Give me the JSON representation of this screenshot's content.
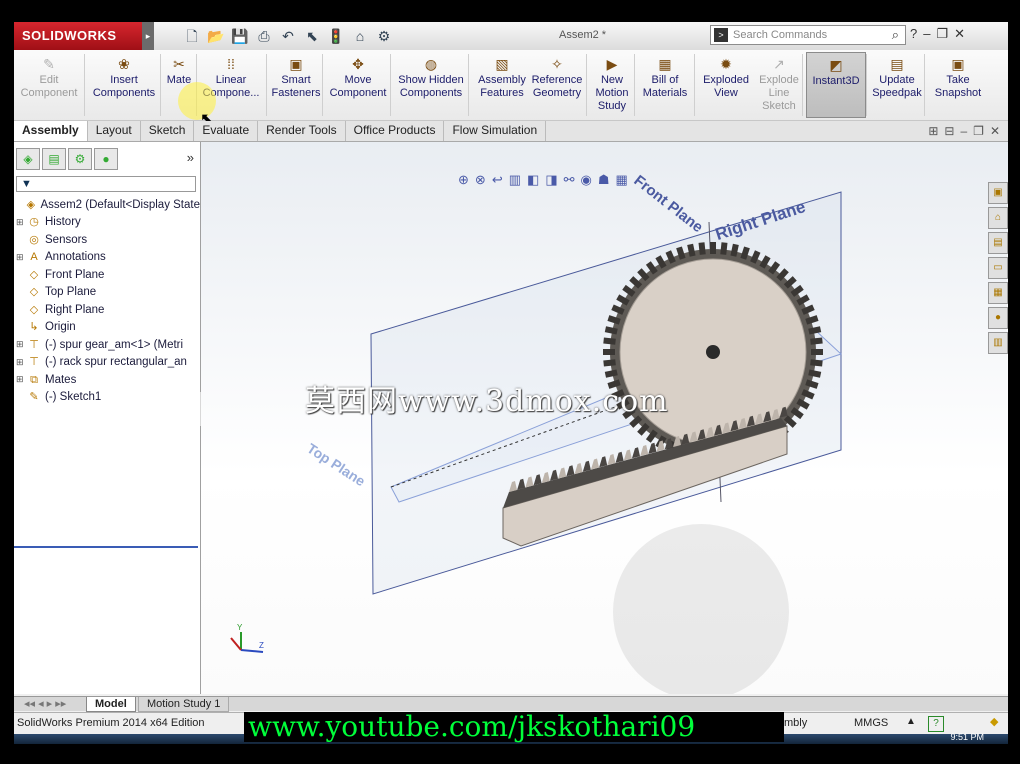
{
  "app": {
    "brand": "SOLIDWORKS",
    "window_title": "Assem2 *",
    "search_placeholder": "Search Commands"
  },
  "ribbon": [
    {
      "id": "edit-component",
      "label": "Edit Component",
      "icon": "edit-component-icon",
      "disabled": true
    },
    {
      "id": "insert-components",
      "label": "Insert Components",
      "icon": "insert-components-icon",
      "disabled": false
    },
    {
      "id": "mate",
      "label": "Mate",
      "icon": "mate-icon",
      "disabled": false
    },
    {
      "id": "linear-component",
      "label": "Linear Compone...",
      "icon": "linear-pattern-icon",
      "disabled": false
    },
    {
      "id": "smart-fasteners",
      "label": "Smart Fasteners",
      "icon": "smart-fasteners-icon",
      "disabled": false
    },
    {
      "id": "move-component",
      "label": "Move Component",
      "icon": "move-component-icon",
      "disabled": false
    },
    {
      "id": "show-hidden",
      "label": "Show Hidden Components",
      "icon": "show-hidden-icon",
      "disabled": false
    },
    {
      "id": "assembly-features",
      "label": "Assembly Features",
      "icon": "assembly-features-icon",
      "disabled": false
    },
    {
      "id": "reference-geometry",
      "label": "Reference Geometry",
      "icon": "reference-geometry-icon",
      "disabled": false
    },
    {
      "id": "new-motion-study",
      "label": "New Motion Study",
      "icon": "motion-study-icon",
      "disabled": false
    },
    {
      "id": "bill-of-materials",
      "label": "Bill of Materials",
      "icon": "bom-icon",
      "disabled": false
    },
    {
      "id": "exploded-view",
      "label": "Exploded View",
      "icon": "exploded-view-icon",
      "disabled": false
    },
    {
      "id": "explode-line-sketch",
      "label": "Explode Line Sketch",
      "icon": "explode-line-icon",
      "disabled": true
    },
    {
      "id": "instant3d",
      "label": "Instant3D",
      "icon": "instant3d-icon",
      "disabled": false,
      "active": true
    },
    {
      "id": "update-speedpak",
      "label": "Update Speedpak",
      "icon": "speedpak-icon",
      "disabled": false
    },
    {
      "id": "take-snapshot",
      "label": "Take Snapshot",
      "icon": "snapshot-icon",
      "disabled": false
    }
  ],
  "tabs": [
    "Assembly",
    "Layout",
    "Sketch",
    "Evaluate",
    "Render Tools",
    "Office Products",
    "Flow Simulation"
  ],
  "active_tab": "Assembly",
  "tree": [
    {
      "label": "Assem2  (Default<Display State",
      "icon": "assembly-icon",
      "exp": ""
    },
    {
      "label": "History",
      "icon": "history-icon",
      "exp": "+"
    },
    {
      "label": "Sensors",
      "icon": "sensors-icon",
      "exp": ""
    },
    {
      "label": "Annotations",
      "icon": "annotations-icon",
      "exp": "+"
    },
    {
      "label": "Front Plane",
      "icon": "plane-icon",
      "exp": ""
    },
    {
      "label": "Top Plane",
      "icon": "plane-icon",
      "exp": ""
    },
    {
      "label": "Right Plane",
      "icon": "plane-icon",
      "exp": ""
    },
    {
      "label": "Origin",
      "icon": "origin-icon",
      "exp": ""
    },
    {
      "label": "(-) spur gear_am<1> (Metri",
      "icon": "part-icon",
      "exp": "+"
    },
    {
      "label": "(-) rack spur rectangular_an",
      "icon": "part-icon",
      "exp": "+"
    },
    {
      "label": "Mates",
      "icon": "mates-icon",
      "exp": "+"
    },
    {
      "label": "(-) Sketch1",
      "icon": "sketch-icon",
      "exp": ""
    }
  ],
  "planes": {
    "front": "Front Plane",
    "right": "Right Plane",
    "top": "Top Plane"
  },
  "watermark": "莫西网www.3dmox.com",
  "bottom_tabs": [
    "Model",
    "Motion Study 1"
  ],
  "status": {
    "edition": "SolidWorks Premium 2014 x64 Edition",
    "mode": "mbly",
    "units": "MMGS",
    "time": "9:51 PM"
  },
  "overlay_url": "www.youtube.com/jkskothari09",
  "colors": {
    "brand": "#c8202a",
    "accent": "#3a5cb5"
  }
}
